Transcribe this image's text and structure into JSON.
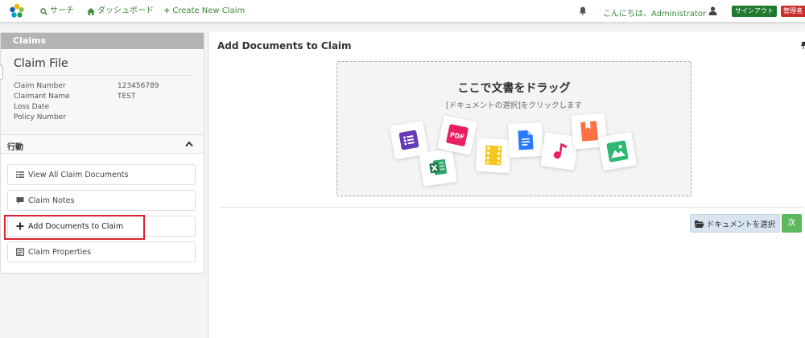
{
  "navbar": {
    "search_label": "サーチ",
    "dashboard_label": "ダッシュボード",
    "create_label": "Create New Claim",
    "greeting": "こんにちは、Administrator",
    "signout_label": "サインアウト",
    "admin_label": "管理者"
  },
  "sidebar": {
    "header": "Claims",
    "claim_file_title": "Claim File",
    "fields": [
      {
        "label": "Claim Number",
        "value": "123456789"
      },
      {
        "label": "Claimant Name",
        "value": "TEST"
      },
      {
        "label": "Loss Date",
        "value": ""
      },
      {
        "label": "Policy Number",
        "value": ""
      }
    ],
    "actions_title": "行動",
    "actions": [
      {
        "label": "View All Claim Documents",
        "icon": "list-icon"
      },
      {
        "label": "Claim Notes",
        "icon": "comment-icon"
      },
      {
        "label": "Add Documents to Claim",
        "icon": "plus-icon"
      },
      {
        "label": "Claim Properties",
        "icon": "properties-icon"
      }
    ]
  },
  "main": {
    "title": "Add Documents to Claim",
    "dropzone_title": "ここで文書をドラッグ",
    "dropzone_subtitle": "[ドキュメントの選択]をクリックします",
    "select_button": "ドキュメントを選択",
    "next_button": "次"
  },
  "colors": {
    "accent_green": "#3c8c3c",
    "signout_bg": "#1e7a2e",
    "admin_bg": "#c9302c",
    "highlight": "#d9232d",
    "next_bg": "#5cb85c"
  }
}
